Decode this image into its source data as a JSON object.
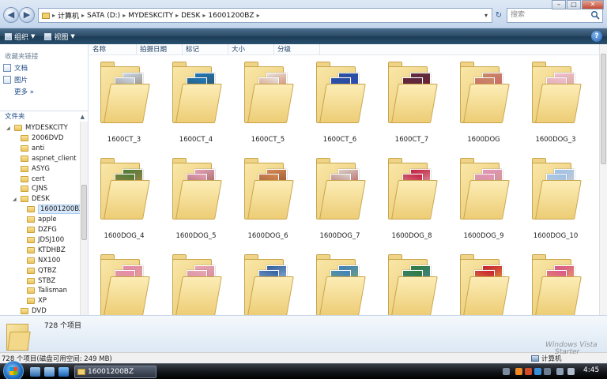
{
  "address": {
    "crumbs": [
      "计算机",
      "SATA (D:)",
      "MYDESKCITY",
      "DESK",
      "16001200BZ"
    ],
    "search_placeholder": "搜索"
  },
  "toolbar": {
    "organize": "组织",
    "views": "视图",
    "help": "?"
  },
  "sidebar": {
    "favorites_header": "收藏夹链接",
    "favorites": [
      "文档",
      "图片"
    ],
    "more": "更多 »",
    "folders_header": "文件夹",
    "tree": [
      {
        "label": "MYDESKCITY",
        "level": 0
      },
      {
        "label": "2006DVD",
        "level": 1
      },
      {
        "label": "anti",
        "level": 1
      },
      {
        "label": "aspnet_client",
        "level": 1
      },
      {
        "label": "ASYG",
        "level": 1
      },
      {
        "label": "cert",
        "level": 1
      },
      {
        "label": "CJNS",
        "level": 1
      },
      {
        "label": "DESK",
        "level": 1
      },
      {
        "label": "16001200BZ",
        "level": 2,
        "selected": true
      },
      {
        "label": "apple",
        "level": 2
      },
      {
        "label": "DZFG",
        "level": 2
      },
      {
        "label": "JDSJ100",
        "level": 2
      },
      {
        "label": "KTDHBZ",
        "level": 2
      },
      {
        "label": "NX100",
        "level": 2
      },
      {
        "label": "QTBZ",
        "level": 2
      },
      {
        "label": "STBZ",
        "level": 2
      },
      {
        "label": "Talisman",
        "level": 2
      },
      {
        "label": "XP",
        "level": 2
      },
      {
        "label": "DVD",
        "level": 1
      }
    ]
  },
  "columns": [
    "名称",
    "拍摄日期",
    "标记",
    "大小",
    "分级"
  ],
  "folders": [
    {
      "name": "1600CT_3",
      "colors": [
        "#c9d7e6",
        "#7c5a3a"
      ]
    },
    {
      "name": "1600CT_4",
      "colors": [
        "#1f79b8",
        "#3b3b3b"
      ]
    },
    {
      "name": "1600CT_5",
      "colors": [
        "#e7e2dc",
        "#c8501e"
      ]
    },
    {
      "name": "1600CT_6",
      "colors": [
        "#2b4f9c",
        "#2b4ad0"
      ]
    },
    {
      "name": "1600CT_7",
      "colors": [
        "#5c2a40",
        "#7a1d27"
      ]
    },
    {
      "name": "1600DOG",
      "colors": [
        "#c88a66",
        "#d24a6c"
      ]
    },
    {
      "name": "1600DOG_3",
      "colors": [
        "#f0bfd0",
        "#c99a7a"
      ]
    },
    {
      "name": "1600DOG_4",
      "colors": [
        "#4c7b33",
        "#d88a5a"
      ]
    },
    {
      "name": "1600DOG_5",
      "colors": [
        "#e5a0b8",
        "#74492f"
      ]
    },
    {
      "name": "1600DOG_6",
      "colors": [
        "#d78a52",
        "#6d3a26"
      ]
    },
    {
      "name": "1600DOG_7",
      "colors": [
        "#d8cfc6",
        "#a61f2b"
      ]
    },
    {
      "name": "1600DOG_8",
      "colors": [
        "#c21d3f",
        "#efe6dc"
      ]
    },
    {
      "name": "1600DOG_9",
      "colors": [
        "#e694b8",
        "#b89a7a"
      ]
    },
    {
      "name": "1600DOG_10",
      "colors": [
        "#9cc0e6",
        "#e0d6cc"
      ]
    },
    {
      "name": "",
      "colors": [
        "#e68aa8",
        "#d6b089"
      ]
    },
    {
      "name": "",
      "colors": [
        "#e9a6b4",
        "#c77a8a"
      ]
    },
    {
      "name": "",
      "colors": [
        "#2f5f9e",
        "#d1e3f5"
      ]
    },
    {
      "name": "",
      "colors": [
        "#3f7fbf",
        "#8fbf4f"
      ]
    },
    {
      "name": "",
      "colors": [
        "#2e7a3a",
        "#4f8fd0"
      ]
    },
    {
      "name": "",
      "colors": [
        "#c61f2f",
        "#f0d24a"
      ]
    },
    {
      "name": "",
      "colors": [
        "#d8568c",
        "#f4c24a"
      ]
    }
  ],
  "details": {
    "count_label": "728 个项目"
  },
  "status": {
    "text": "728 个项目(磁盘可用空间: 249 MB)",
    "computer": "计算机"
  },
  "watermark": [
    "Windows Vista",
    "Starter"
  ],
  "taskbar": {
    "window_button": "16001200BZ",
    "time": "4:45"
  }
}
